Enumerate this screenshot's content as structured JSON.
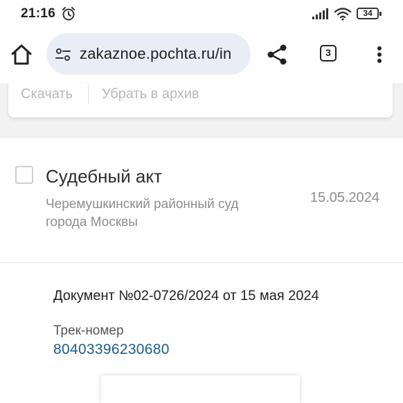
{
  "status_bar": {
    "time": "21:16",
    "battery": "34"
  },
  "browser": {
    "url": "zakaznoe.pochta.ru/in",
    "tab_count": "3"
  },
  "actions": {
    "download": "Скачать",
    "archive": "Убрать в архив"
  },
  "document": {
    "title": "Судебный акт",
    "sender": "Черемушкинский районный суд города Москвы",
    "date": "15.05.2024",
    "number": "Документ №02-0726/2024 от 15 мая 2024",
    "track_label": "Трек-номер",
    "track_number": "80403396230680"
  },
  "colors": {
    "url_bar_bg": "#e9eef6",
    "page_bg": "#f2f2f2",
    "link": "#1a5e88",
    "muted_text": "#8e8e8e"
  }
}
